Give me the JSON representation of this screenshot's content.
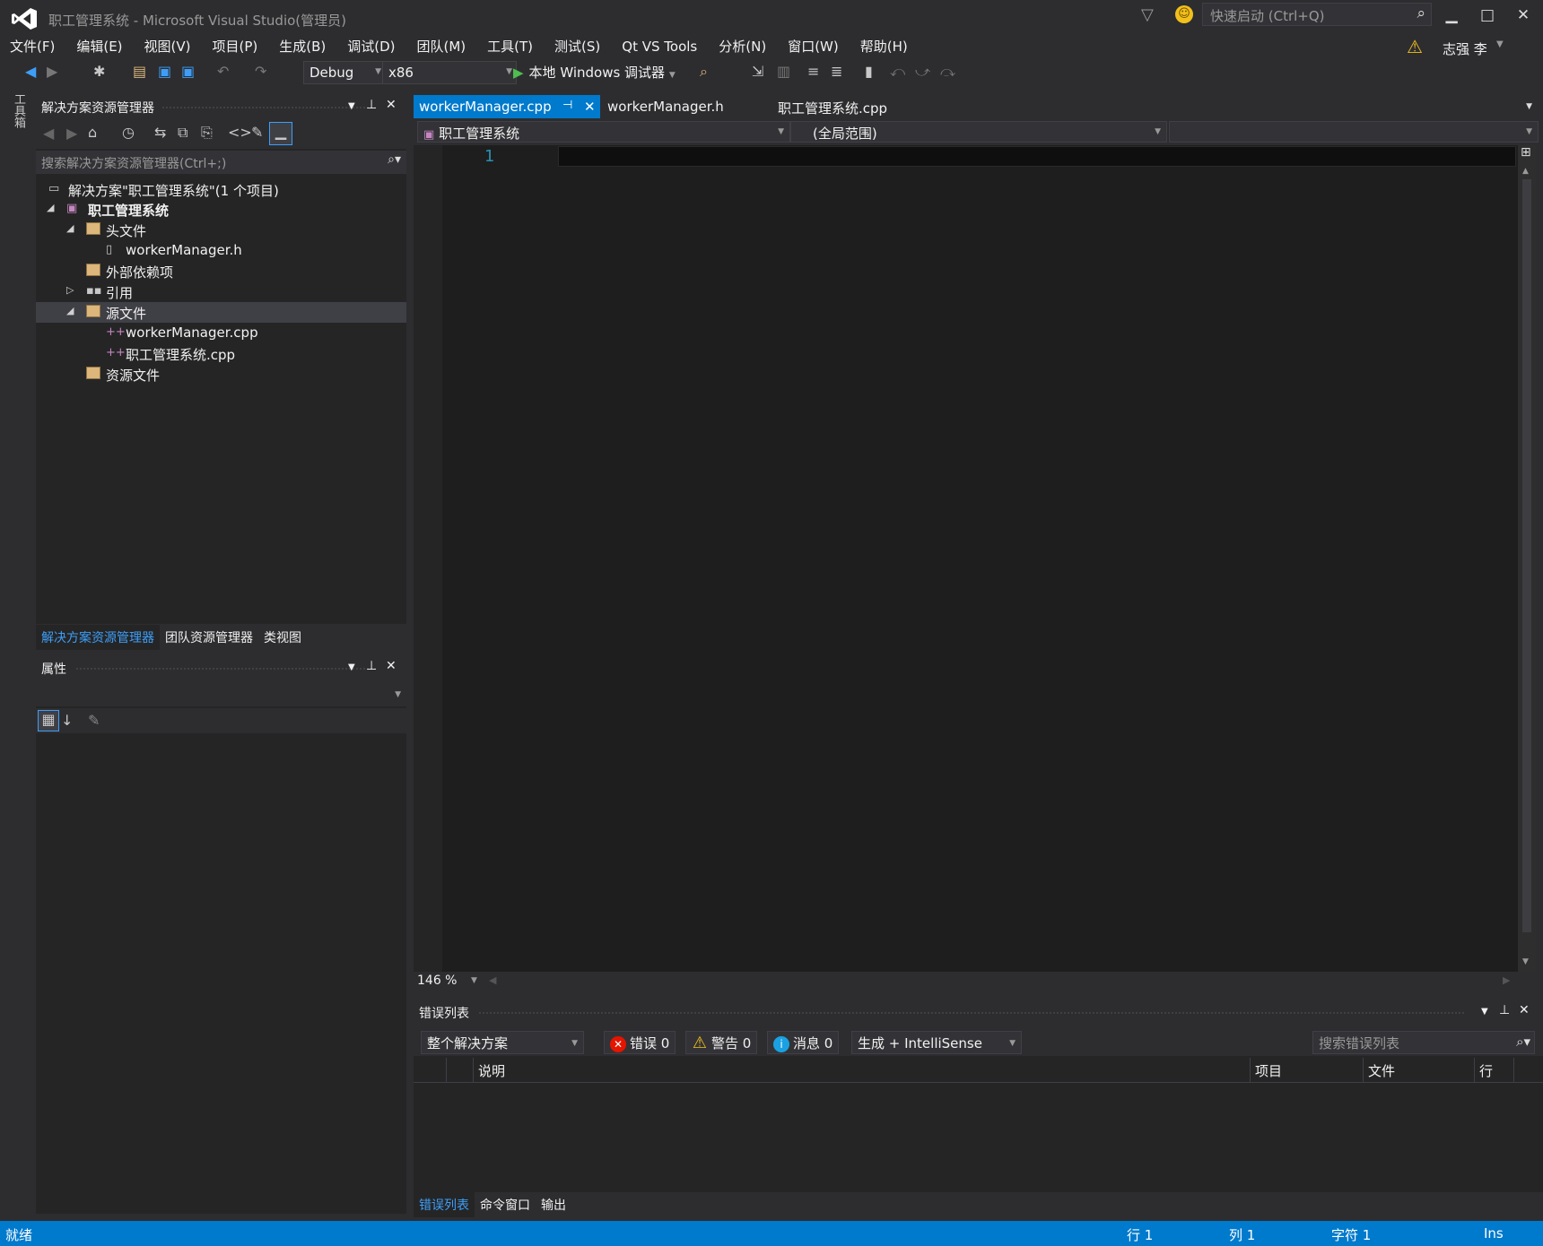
{
  "window": {
    "title": "职工管理系统 - Microsoft Visual Studio(管理员)",
    "quick_launch_placeholder": "快速启动 (Ctrl+Q)",
    "user_name": "志强 李"
  },
  "menu": [
    "文件(F)",
    "编辑(E)",
    "视图(V)",
    "项目(P)",
    "生成(B)",
    "调试(D)",
    "团队(M)",
    "工具(T)",
    "测试(S)",
    "Qt VS Tools",
    "分析(N)",
    "窗口(W)",
    "帮助(H)"
  ],
  "toolbar": {
    "config": "Debug",
    "platform": "x86",
    "run_label": "本地 Windows 调试器"
  },
  "left_strip": {
    "toolbox": "工具箱"
  },
  "solution_explorer": {
    "title": "解决方案资源管理器",
    "search_placeholder": "搜索解决方案资源管理器(Ctrl+;)",
    "tree": [
      {
        "label": "解决方案\"职工管理系统\"(1 个项目)"
      },
      {
        "label": "职工管理系统"
      },
      {
        "label": "头文件"
      },
      {
        "label": "workerManager.h"
      },
      {
        "label": "外部依赖项"
      },
      {
        "label": "引用"
      },
      {
        "label": "源文件"
      },
      {
        "label": "workerManager.cpp"
      },
      {
        "label": "职工管理系统.cpp"
      },
      {
        "label": "资源文件"
      }
    ],
    "bottom_tabs": [
      "解决方案资源管理器",
      "团队资源管理器",
      "类视图"
    ]
  },
  "properties": {
    "title": "属性"
  },
  "editor": {
    "tabs": [
      "workerManager.cpp",
      "workerManager.h",
      "职工管理系统.cpp"
    ],
    "nav_project": "职工管理系统",
    "nav_scope": "(全局范围)",
    "line_number": "1",
    "zoom": "146 %"
  },
  "error_list": {
    "title": "错误列表",
    "scope": "整个解决方案",
    "errors_label": "错误 0",
    "warnings_label": "警告 0",
    "messages_label": "消息 0",
    "build_filter": "生成 + IntelliSense",
    "search_placeholder": "搜索错误列表",
    "columns": [
      "说明",
      "项目",
      "文件",
      "行"
    ],
    "bottom_tabs": [
      "错误列表",
      "命令窗口",
      "输出"
    ]
  },
  "status_bar": {
    "state": "就绪",
    "line": "行 1",
    "col": "列 1",
    "char": "字符 1",
    "mode": "Ins"
  },
  "colors": {
    "accent": "#007acc",
    "background": "#2d2d30",
    "editor_bg": "#1e1e1e"
  }
}
